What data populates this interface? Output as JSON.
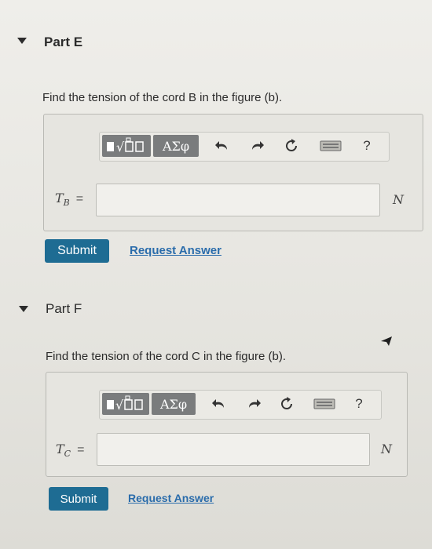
{
  "part_e": {
    "title": "Part E",
    "prompt": "Find the tension of the cord B in the figure (b).",
    "toolbar": {
      "templates_icon": "templates-icon",
      "symbols_label": "ΑΣφ",
      "help_label": "?"
    },
    "variable": "T",
    "subscript": "B",
    "equals": "=",
    "input_value": "",
    "unit": "N",
    "submit_label": "Submit",
    "request_label": "Request Answer"
  },
  "part_f": {
    "title": "Part F",
    "prompt": "Find the tension of the cord C in the figure (b).",
    "toolbar": {
      "templates_icon": "templates-icon",
      "symbols_label": "ΑΣφ",
      "help_label": "?"
    },
    "variable": "T",
    "subscript": "C",
    "equals": "=",
    "input_value": "",
    "unit": "N",
    "submit_label": "Submit",
    "request_label": "Request Answer"
  },
  "colors": {
    "submit": "#1e6c93",
    "link": "#2a6cab",
    "tool_button": "#7a7c7d"
  }
}
